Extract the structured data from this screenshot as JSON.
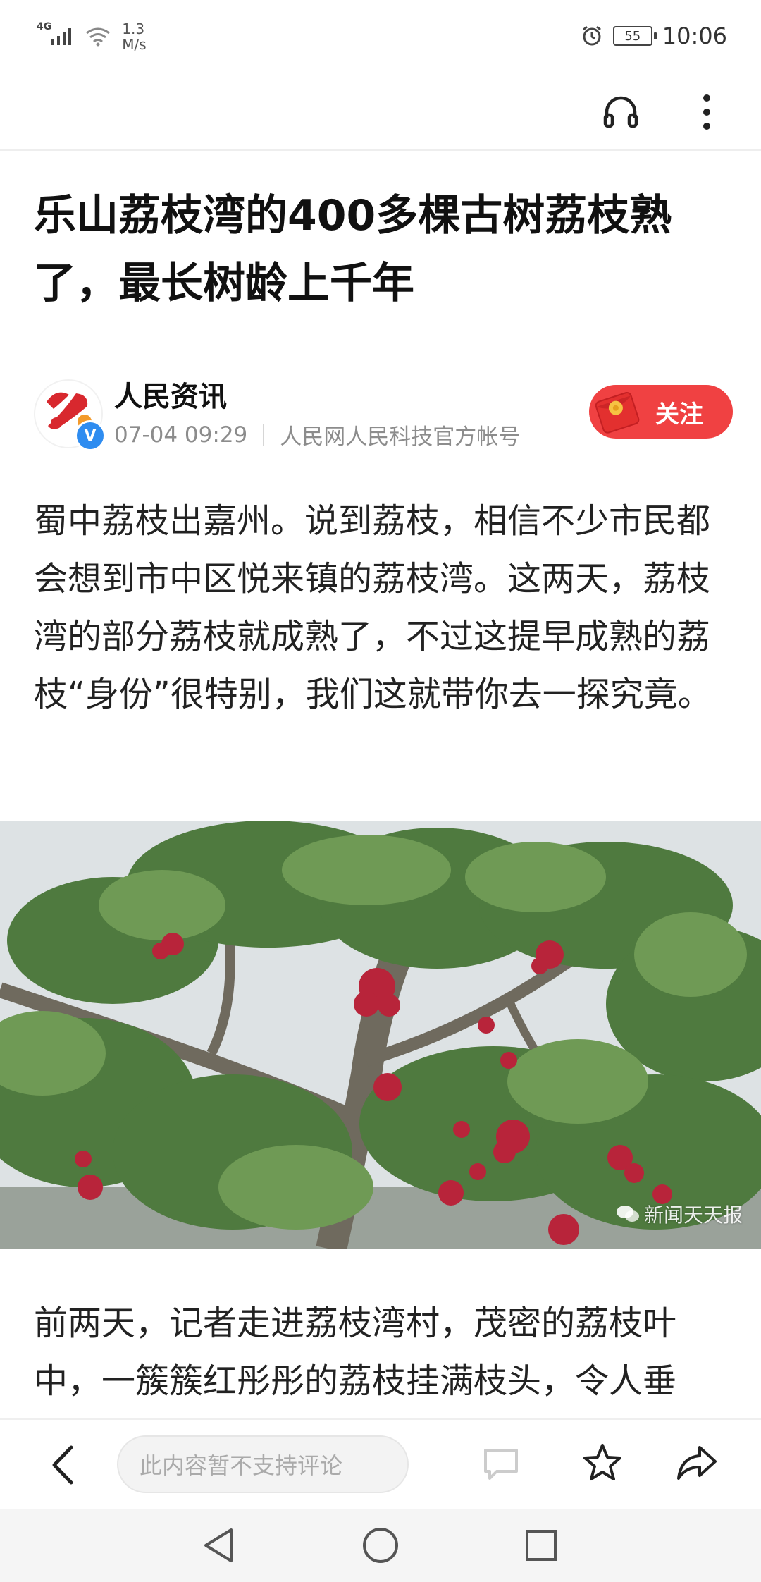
{
  "status_bar": {
    "network_type": "4G",
    "speed_value": "1.3",
    "speed_unit": "M/s",
    "battery": "55",
    "time": "10:06"
  },
  "icons": {
    "signal": "signal-icon",
    "wifi": "wifi-icon",
    "alarm": "alarm-icon",
    "headphones": "headphones-icon",
    "more": "more-vertical-icon",
    "back": "chevron-left-icon",
    "comment": "comment-icon",
    "favorite": "star-icon",
    "share": "share-icon",
    "nav_back": "triangle-back-icon",
    "nav_home": "circle-home-icon",
    "nav_recent": "square-recent-icon",
    "red_envelope": "red-envelope-icon",
    "verified": "verified-badge-icon"
  },
  "article": {
    "title": "乐山荔枝湾的400多棵古树荔枝熟了，最长树龄上千年",
    "author": {
      "name": "人民资讯",
      "date": "07-04 09:29",
      "description": "人民网人民科技官方帐号",
      "verified_mark": "V"
    },
    "follow_label": "关注",
    "paragraphs": [
      "蜀中荔枝出嘉州。说到荔枝，相信不少市民都会想到市中区悦来镇的荔枝湾。这两天，荔枝湾的部分荔枝就成熟了，不过这提早成熟的荔枝“身份”很特别，我们这就带你去一探究竟。",
      "前两天，记者走进荔枝湾村，茂密的荔枝叶中，一簇簇红彤彤的荔枝挂满枝头，令人垂"
    ],
    "image_watermark": "新闻天天报"
  },
  "bottom_bar": {
    "comment_placeholder": "此内容暂不支持评论"
  },
  "colors": {
    "accent_red": "#f04142",
    "text_primary": "#111111",
    "text_secondary": "#8c8c8c"
  }
}
